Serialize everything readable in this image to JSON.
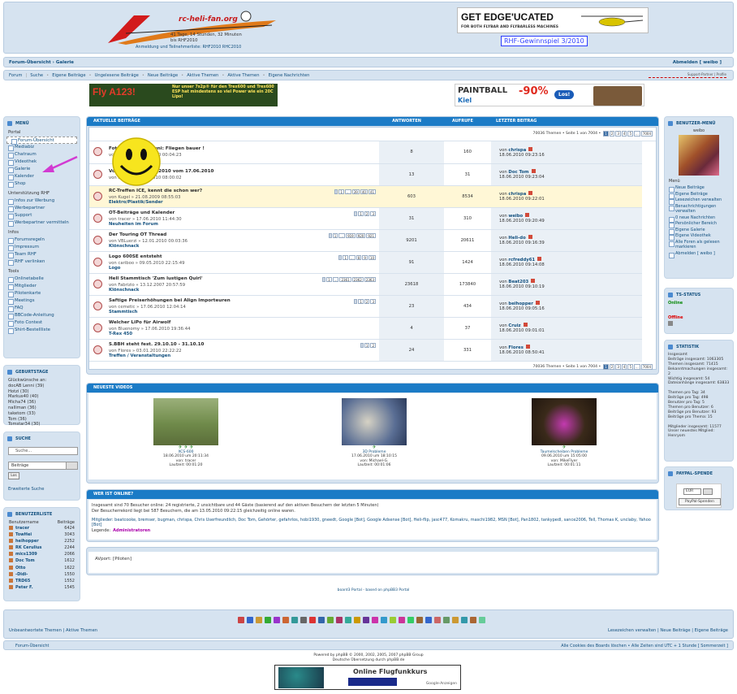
{
  "header": {
    "logo_text": "rc-heli-fan.org",
    "uptime": "41 Tage, 14 Stunden, 32 Minuten",
    "until": "bis RHF2010",
    "regtext": "Anmeldung und Teilnehmerliste: RHF2010    RHC2010",
    "banner_top": "GET EDGE'UCATED",
    "banner_sub": "FOR BOTH FLYBAR AND FLYBARLESS MACHINES",
    "gewinnspiel": "RHF-Gewinnspiel 3/2010"
  },
  "crumb": {
    "left": "Forum-Übersicht › Galerie",
    "right": "Abmelden [ weibo ]"
  },
  "nav": {
    "items": [
      "Forum",
      "Suche",
      "Eigene Beiträge",
      "Ungelesene Beiträge",
      "Neue Beiträge",
      "Aktive Themen",
      "Aktive Themen",
      "Eigene Nachrichten"
    ],
    "support": "Support-Partner | Profile"
  },
  "ads": {
    "fly_title": "Fly A123!",
    "fly_text": "Nur unser 7s2p® für den Trex600 und Trex600 ESP hat mindestens so viel Power wie ein 20C Lipo!",
    "paintball": "PAINTBALL",
    "kiel": "Kiel",
    "percent": "-90%",
    "los": "Los!"
  },
  "menu": {
    "title": "MENÜ",
    "sec1": "Portal",
    "items1": [
      "Forum-Übersicht",
      "Mediabiz",
      "Chatraum",
      "Videothek",
      "Galerie",
      "Kalender",
      "Shop"
    ],
    "sec2": "Unterstützung RHF",
    "items2": [
      "Infos zur Werbung",
      "Werbepartner",
      "Support",
      "Werbepartner vermitteln"
    ],
    "sec3": "Infos",
    "items3": [
      "Forumsregeln",
      "Impressum",
      "Team RHF",
      "RHF verlinken"
    ],
    "sec4": "Tools",
    "items4": [
      "Onlinetabelle",
      "Mitglieder",
      "Pilotenkarte",
      "Meetings",
      "FAQ",
      "BBCode-Anleitung",
      "Foto Contest",
      "Shirt-Bestellliste"
    ]
  },
  "birthdays": {
    "title": "GEBURTSTAGE",
    "label": "Glückwünsche an:",
    "items": [
      "docAB Lenni (39)",
      "Hotzi (30)",
      "Markus40 (40)",
      "Micha74 (36)",
      "nalliman (36)",
      "taketom (33)",
      "Tom (36)",
      "Tomstar34 (30)"
    ]
  },
  "search": {
    "title": "SUCHE",
    "placeholder": "Suche...",
    "select": "Beiträge",
    "go": "Los",
    "adv": "Erweiterte Suche"
  },
  "ranking": {
    "title": "BENUTZERLISTE",
    "col1": "Benutzername",
    "col2": "Beiträge",
    "rows": [
      [
        "tracer",
        "6424"
      ],
      [
        "TowHei",
        "3043"
      ],
      [
        "heihopper",
        "2252"
      ],
      [
        "RK Cerulius",
        "2244"
      ],
      [
        "mics1309",
        "2066"
      ],
      [
        "Doc Tom",
        "1612"
      ],
      [
        "Otto",
        "1622"
      ],
      [
        "-Didi-",
        "1550"
      ],
      [
        "TRD65",
        "1552"
      ],
      [
        "Peter F.",
        "1545"
      ]
    ]
  },
  "topics": {
    "title": "AKTUELLE BEITRÄGE",
    "col_answers": "ANTWORTEN",
    "col_views": "AUFRUFE",
    "col_last": "LETZTER BEITRAG",
    "pager_label": "70036 Themen • Seite 1 von 7004 •",
    "pages": [
      "1",
      "2",
      "3",
      "4",
      "5",
      "...",
      "7004"
    ],
    "rows": [
      {
        "title": "Fotowettbewerb Juni: Fliegen bauer !",
        "meta": "von tracer » 17.06.2010 00:04:23",
        "forum": "",
        "answers": "8",
        "views": "160",
        "last_by": "chrispa",
        "last_date": "18.06.2010 09:23:16",
        "hl": false,
        "pages": []
      },
      {
        "title": "Vorschläge Galerie 2010 vom 17.06.2010",
        "meta": "von Flores » 17.06.2010 08:00:02",
        "forum": "",
        "answers": "13",
        "views": "31",
        "last_by": "Doc Tom",
        "last_date": "18.06.2010 09:23:04",
        "hl": false,
        "pages": []
      },
      {
        "title": "RC-Treffen ICE, kennt die schon wer?",
        "meta": "von Kugel » 21.08.2009 08:55:03",
        "forum": "Elektro/Plastik/Sender",
        "answers": "603",
        "views": "8534",
        "last_by": "chrispa",
        "last_date": "18.06.2010 09:22:01",
        "hl": true,
        "pages": [
          "1",
          "...",
          "39",
          "40",
          "41"
        ]
      },
      {
        "title": "OT-Beiträge und Kalender",
        "meta": "von tracer » 17.06.2010 11:44:30",
        "forum": "Neuheiten im Forum",
        "answers": "31",
        "views": "310",
        "last_by": "weibo",
        "last_date": "18.06.2010 09:20:49",
        "hl": false,
        "pages": [
          "1",
          "2",
          "3"
        ]
      },
      {
        "title": "Der Touring OT Thread",
        "meta": "von VBLuerzi » 12.01.2010 00:03:36",
        "forum": "Klönschnack",
        "answers": "9201",
        "views": "20611",
        "last_by": "Heli-do",
        "last_date": "18.06.2010 09:16:39",
        "hl": false,
        "pages": [
          "1",
          "...",
          "919",
          "920",
          "921"
        ]
      },
      {
        "title": "Logo 600SE entsteht",
        "meta": "von cariboo » 09.05.2010 22:15:49",
        "forum": "Logo",
        "answers": "91",
        "views": "1424",
        "last_by": "rcfreddy61",
        "last_date": "18.06.2010 09:14:08",
        "hl": false,
        "pages": [
          "1",
          "...",
          "8",
          "9",
          "10"
        ]
      },
      {
        "title": "Hell Stammtisch 'Zum lustigen Quirl'",
        "meta": "von Fabrizio » 13.12.2007 20:57:59",
        "forum": "Klönschnack",
        "answers": "23618",
        "views": "173840",
        "last_by": "Beat203",
        "last_date": "18.06.2010 09:10:19",
        "hl": false,
        "pages": [
          "1",
          "...",
          "2361",
          "2362",
          "2363"
        ]
      },
      {
        "title": "Saftige Preiserhöhungen bei Align Importeuren",
        "meta": "von cemetic » 17.06.2010 12:04:14",
        "forum": "Stammtisch",
        "answers": "23",
        "views": "434",
        "last_by": "beihopper",
        "last_date": "18.06.2010 09:05:16",
        "hl": false,
        "pages": [
          "1",
          "2",
          "3"
        ]
      },
      {
        "title": "Welcher LiPo für Airwolf",
        "meta": "von Bluenomy » 17.06.2010 19:36:44",
        "forum": "T-Rex 450",
        "answers": "4",
        "views": "37",
        "last_by": "Cruiz",
        "last_date": "18.06.2010 09:01:01",
        "hl": false,
        "pages": []
      },
      {
        "title": "S.BBH steht fest. 29.10.10 - 31.10.10",
        "meta": "von Flores » 03.01.2010 22:22:22",
        "forum": "Treffen / Veranstaltungen",
        "answers": "24",
        "views": "331",
        "last_by": "Flores",
        "last_date": "18.06.2010 08:50:41",
        "hl": false,
        "pages": [
          "1",
          "2"
        ]
      }
    ]
  },
  "videos": {
    "title": "NEUESTE VIDEOS",
    "items": [
      {
        "name": "XCS-600",
        "date": "18.06.2010 um 20:11:34",
        "by": "von: tracer",
        "time": "Laufzeit: 00:01:20"
      },
      {
        "name": "3D Probleme",
        "date": "17.06.2010 um 18:10:15",
        "by": "von: Michael-G.",
        "time": "Laufzeit: 00:01:06"
      },
      {
        "name": "Taumelscheiben Probleme",
        "date": "09.06.2010 um 15:05:00",
        "by": "von: MikeFlyer",
        "time": "Laufzeit: 00:01:11"
      }
    ]
  },
  "whoonline": {
    "title": "WER IST ONLINE?",
    "line1": "Insgesamt sind 70 Besucher online: 24 registrierte, 2 unsichtbare und 44 Gäste (basierend auf den aktiven Besuchern der letzten 5 Minuten)",
    "line2": "Der Besucherrekord liegt bei 587 Besuchern, die am 13.05.2010 09:22:15 gleichzeitig online waren.",
    "users": "Mitglieder: beatcooke, bremser, bugman, chrispa, Chris Userfreundlich, Doc Tom, Gehörter, gefahrlos, hobi1930, gneedt, Google [Bot], Google Adsense [Bot], Heli-flip, jasc477, Komakru, maschi1982, MSN [Bot], Pan1802, tankypedl, sance2006, Tell, Thomas K, unclaby, Yahoo [Bot]",
    "legend_label": "Legende:",
    "legend": "Administratoren"
  },
  "chat": {
    "text": "AVport: [Piloten]"
  },
  "footer_note": "board3 Portal - based on phpBB3 Portal",
  "userbox": {
    "title": "BENUTZER-MENÜ",
    "name": "weibo",
    "menu_label": "Menü",
    "items": [
      "Neue Beiträge",
      "Eigene Beiträge",
      "Lesezeichen verwalten",
      "Benachrichtigungen verwalten",
      "0 neue Nachrichten",
      "Persönlicher Bereich",
      "Eigene Galerie",
      "Eigene Videothek",
      "Alle Foren als gelesen markieren",
      "Abmelden [ weibo ]"
    ]
  },
  "teamspeak": {
    "title": "TS-STATUS",
    "online": "Online",
    "offline": "Offline"
  },
  "stats": {
    "title": "STATISTIK",
    "lines": [
      "Insgesamt",
      "Beiträge insgesamt: 1063305",
      "Themen insgesamt: 71415",
      "Bekanntmachungen insgesamt: 2",
      "Wichtig insgesamt: 54",
      "Dateianhänge insgesamt: 63833",
      "",
      "Themen pro Tag: 34",
      "Beiträge pro Tag: 498",
      "Benutzer pro Tag: 5",
      "Themen pro Benutzer: 6",
      "Beiträge pro Benutzer: 93",
      "Beiträge pro Thema: 15",
      "",
      "Mitglieder insgesamt: 11577",
      "Unser neuestes Mitglied: Henryom"
    ]
  },
  "paypal": {
    "title": "PAYPAL-SPENDE",
    "currency": "EUR",
    "button": "PayPal-Spenden"
  },
  "footerbar": {
    "left": "Unbeantwortete Themen | Aktive Themen",
    "right": "Lesezeichen verwalten | Neue Beiträge | Eigene Beiträge",
    "crumb": "Forum-Übersicht",
    "crumb_right": "Alle Cookies des Boards löschen • Alle Zeiten sind UTC + 1 Stunde [ Sommerzeit ]"
  },
  "powered": {
    "line1": "Powered by phpBB © 2000, 2002, 2005, 2007 phpBB Group",
    "line2": "Deutsche Übersetzung durch phpBB.de"
  },
  "bottom_ad": {
    "title": "Online Flugfunkkurs",
    "google": "Google-Anzeigen"
  }
}
